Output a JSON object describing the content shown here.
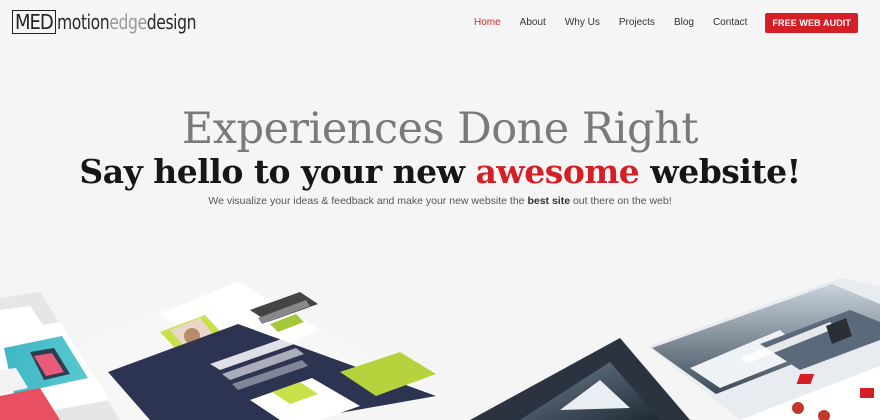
{
  "brand": {
    "logo_box": "MED",
    "logo_part1": "motion",
    "logo_part2": "edge",
    "logo_part3": "design"
  },
  "nav": {
    "items": [
      {
        "label": "Home",
        "active": true
      },
      {
        "label": "About",
        "active": false
      },
      {
        "label": "Why Us",
        "active": false
      },
      {
        "label": "Projects",
        "active": false
      },
      {
        "label": "Blog",
        "active": false
      },
      {
        "label": "Contact",
        "active": false
      }
    ],
    "cta_label": "FREE WEB AUDIT"
  },
  "hero": {
    "title": "Experiences Done Right",
    "subtitle_pre": "Say hello to your new ",
    "subtitle_accent": "awesome",
    "subtitle_post": " website!",
    "desc_pre": "We visualize your ideas & feedback and make your new website the ",
    "desc_bold": "best site",
    "desc_post": " out there on the web!"
  },
  "colors": {
    "accent": "#d41f26",
    "background": "#f5f5f5",
    "text": "#161616"
  }
}
